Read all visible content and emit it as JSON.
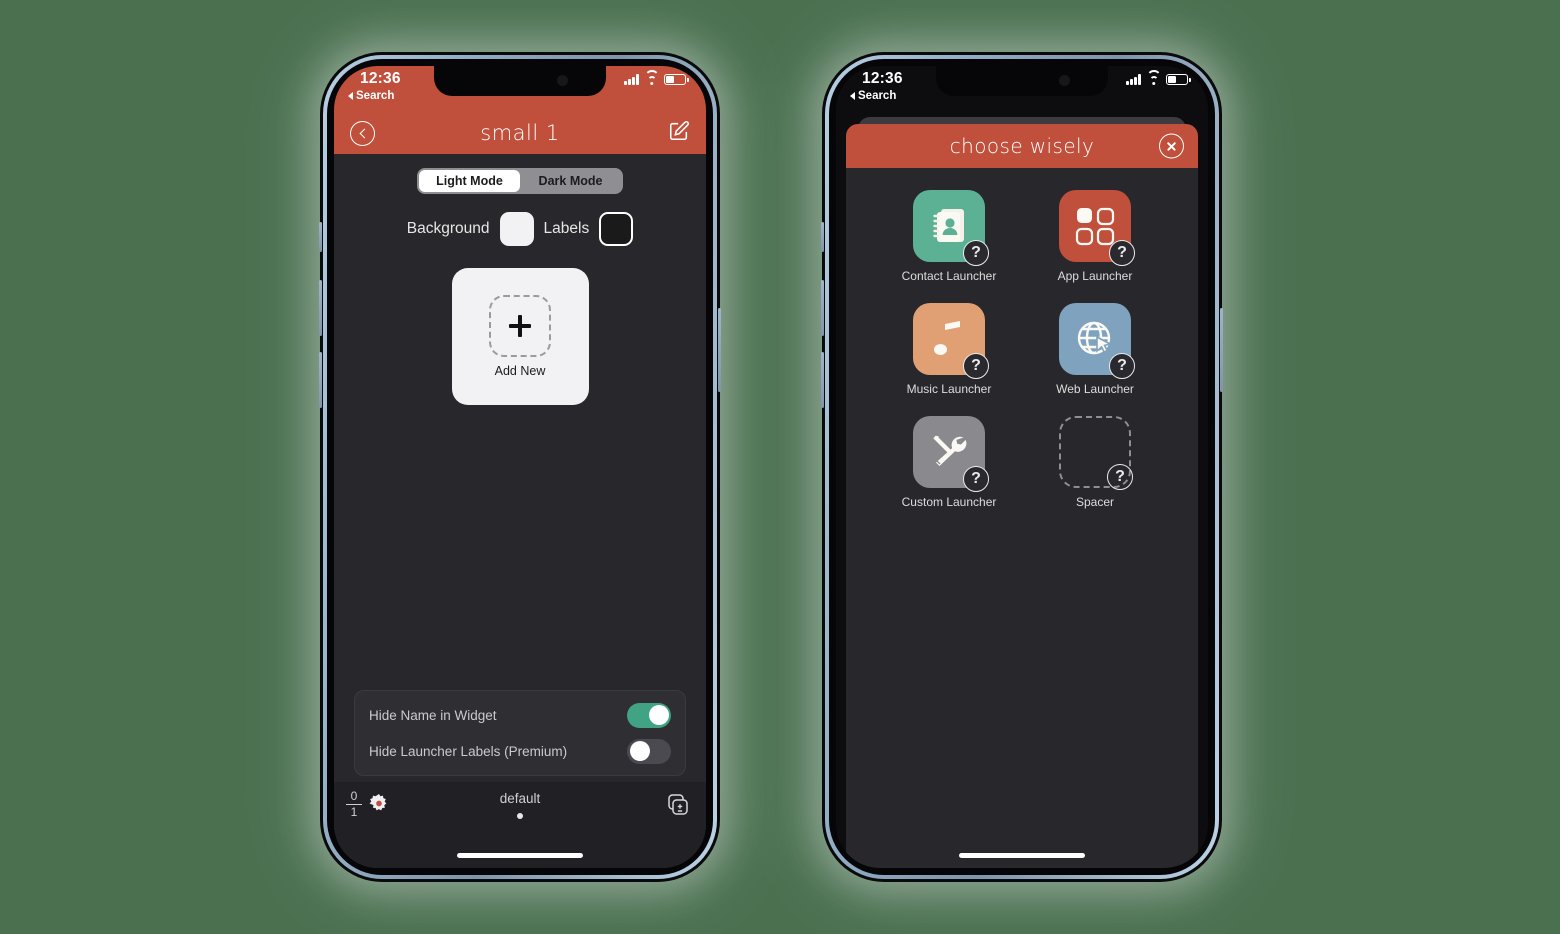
{
  "colors": {
    "page_background": "#4a7050",
    "accent_red": "#c0503c",
    "screen_dark": "#28282c",
    "toggle_on_green": "#3fa384",
    "contact_icon": "#5cb195",
    "app_icon": "#c0503c",
    "music_icon": "#e0a074",
    "web_icon": "#7fa3be",
    "custom_icon": "#8a8a8e"
  },
  "left_phone": {
    "status_bar": {
      "time": "12:36",
      "back_label": "Search",
      "signal_icon": "cellular-bars-icon",
      "wifi_icon": "wifi-icon",
      "battery_icon": "battery-icon"
    },
    "nav": {
      "back_icon": "back-chevron-icon",
      "title": "small 1",
      "edit_icon": "compose-edit-icon"
    },
    "segmented": {
      "options": [
        "Light Mode",
        "Dark Mode"
      ],
      "selected": "Light Mode"
    },
    "color_pickers": [
      {
        "label": "Background",
        "value": "#f2f2f5"
      },
      {
        "label": "Labels",
        "value": "#1a1a1a"
      }
    ],
    "add_card": {
      "plus_icon": "plus-icon",
      "label": "Add New"
    },
    "toggles": [
      {
        "label": "Hide Name in Widget",
        "state": "on"
      },
      {
        "label": "Hide Launcher Labels (Premium)",
        "state": "off"
      }
    ],
    "bottom_bar": {
      "counter_top": "0",
      "counter_bottom": "1",
      "settings_icon": "gear-icon",
      "page_name": "default",
      "page_dot": "page-indicator-dot",
      "duplicate_icon": "duplicate-layers-icon"
    }
  },
  "right_phone": {
    "status_bar": {
      "time": "12:36",
      "back_label": "Search",
      "signal_icon": "cellular-bars-icon",
      "wifi_icon": "wifi-icon",
      "battery_icon": "battery-icon"
    },
    "sheet": {
      "title": "choose wisely",
      "close_icon": "close-x-icon"
    },
    "launchers": [
      {
        "label": "Contact Launcher",
        "icon": "contact-book-icon",
        "color": "#5cb195",
        "badge": "?"
      },
      {
        "label": "App Launcher",
        "icon": "app-grid-icon",
        "color": "#c0503c",
        "badge": "?"
      },
      {
        "label": "Music Launcher",
        "icon": "music-note-icon",
        "color": "#e0a074",
        "badge": "?"
      },
      {
        "label": "Web Launcher",
        "icon": "globe-cursor-icon",
        "color": "#7fa3be",
        "badge": "?"
      },
      {
        "label": "Custom Launcher",
        "icon": "tools-icon",
        "color": "#8a8a8e",
        "badge": "?"
      },
      {
        "label": "Spacer",
        "icon": "dashed-spacer-icon",
        "color": "none",
        "badge": "?"
      }
    ]
  }
}
